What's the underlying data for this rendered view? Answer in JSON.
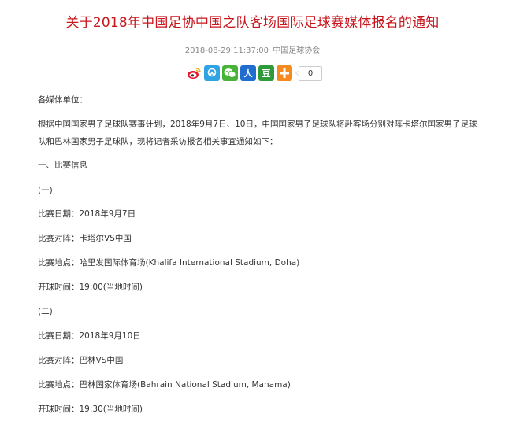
{
  "article": {
    "title": "关于2018年中国足协中国之队客场国际足球赛媒体报名的通知",
    "date": "2018-08-29 11:37:00",
    "source": "中国足球协会"
  },
  "share": {
    "buttons": [
      {
        "name": "weibo-share-button",
        "icon": "weibo-icon",
        "color": "#ffffff"
      },
      {
        "name": "qzone-share-button",
        "icon": "qzone-icon",
        "color": "#2fa3e4"
      },
      {
        "name": "wechat-share-button",
        "icon": "wechat-icon",
        "color": "#48b338"
      },
      {
        "name": "renren-share-button",
        "icon": "renren-icon",
        "color": "#1f6ecf"
      },
      {
        "name": "douban-share-button",
        "icon": "douban-icon",
        "color": "#2f9a3a"
      },
      {
        "name": "more-share-button",
        "icon": "plus-icon",
        "color": "#f58a1f"
      }
    ],
    "renren_glyph": "人",
    "douban_glyph": "豆",
    "count": "0"
  },
  "body": {
    "salutation": "各媒体单位：",
    "intro": "根据中国国家男子足球队赛事计划，2018年9月7日、10日，中国国家男子足球队将赴客场分别对阵卡塔尔国家男子足球队和巴林国家男子足球队，现将记者采访报名相关事宜通知如下：",
    "section1_heading": "一、比赛信息",
    "match1_heading": "(一)",
    "match1_date": "比赛日期：2018年9月7日",
    "match1_teams": "比赛对阵：卡塔尔VS中国",
    "match1_venue": "比赛地点：哈里发国际体育场(Khalifa International Stadium, Doha)",
    "match1_kickoff": "开球时间：19:00(当地时间)",
    "match2_heading": "(二)",
    "match2_date": "比赛日期：2018年9月10日",
    "match2_teams": "比赛对阵：巴林VS中国",
    "match2_venue": "比赛地点：巴林国家体育场(Bahrain National Stadium, Manama)",
    "match2_kickoff": "开球时间：19:30(当地时间)"
  }
}
